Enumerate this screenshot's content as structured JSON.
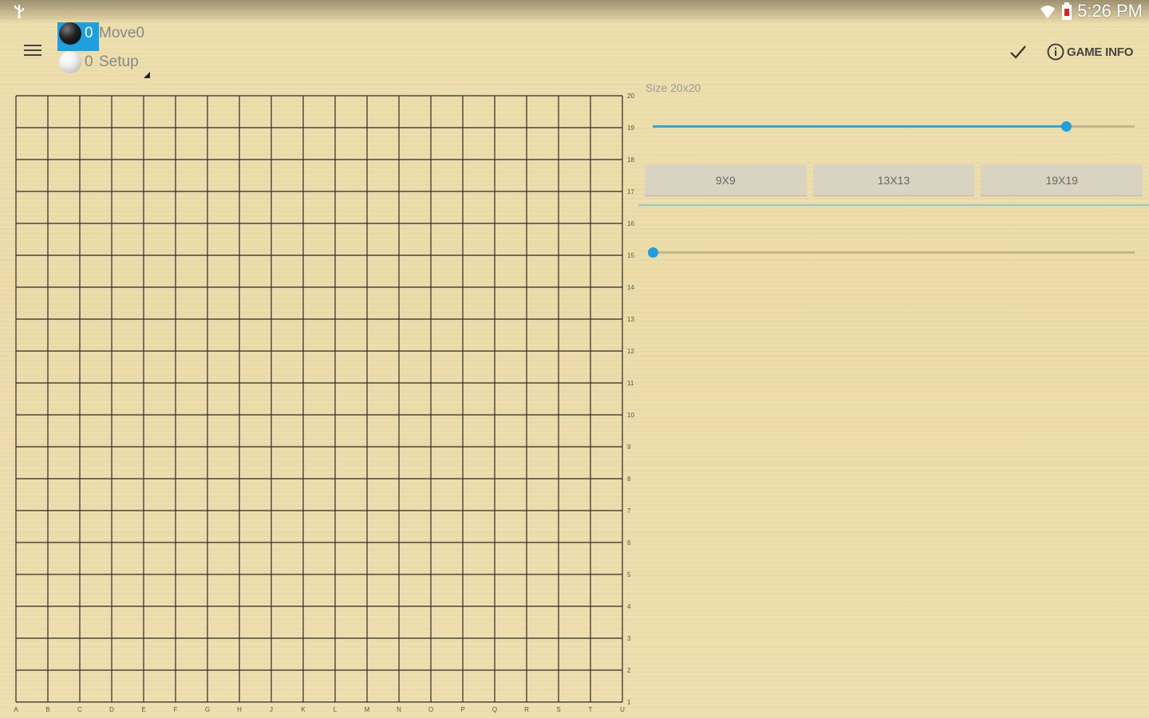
{
  "status_bar": {
    "time": "5:26 PM"
  },
  "players": {
    "black": {
      "count": "0",
      "label": "Move0"
    },
    "white": {
      "count": "0",
      "label": "Setup"
    }
  },
  "toolbar": {
    "game_info_label": "GAME INFO"
  },
  "board": {
    "columns": [
      "A",
      "B",
      "C",
      "D",
      "E",
      "F",
      "G",
      "H",
      "J",
      "K",
      "L",
      "M",
      "N",
      "O",
      "P",
      "Q",
      "R",
      "S",
      "T",
      "U"
    ],
    "rows": [
      "20",
      "19",
      "18",
      "17",
      "16",
      "15",
      "14",
      "13",
      "12",
      "11",
      "10",
      "9",
      "8",
      "7",
      "6",
      "5",
      "4",
      "3",
      "2",
      "1"
    ]
  },
  "size_control": {
    "label": "Size 20x20",
    "slider_fraction": 0.857,
    "presets": [
      "9X9",
      "13X13",
      "19X19"
    ]
  },
  "move_slider": {
    "fraction": 0.0
  },
  "colors": {
    "accent": "#1e9fe0",
    "board_line": "#2a2a2a"
  }
}
